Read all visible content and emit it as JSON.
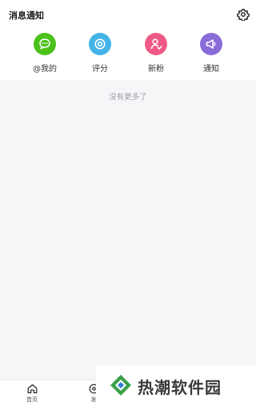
{
  "header": {
    "title": "消息通知",
    "settings_icon": "gear-icon"
  },
  "categories": [
    {
      "label": "@我的",
      "icon": "chat-bubble-icon",
      "color": "#4cc11a"
    },
    {
      "label": "评分",
      "icon": "rating-target-icon",
      "color": "#44b3e7"
    },
    {
      "label": "新粉",
      "icon": "new-follower-icon",
      "color": "#ee5a86"
    },
    {
      "label": "通知",
      "icon": "megaphone-icon",
      "color": "#8a6cd8"
    }
  ],
  "status": {
    "empty_text": "没有更多了"
  },
  "tabbar": {
    "items": [
      {
        "label": "首页",
        "icon": "home-icon"
      },
      {
        "label": "发",
        "icon": "discover-icon"
      }
    ]
  },
  "watermark": {
    "text": "热潮软件园",
    "icon": "diamond-logo"
  },
  "colors": {
    "background": "#f5f6f8",
    "muted_text": "#9b9ea4"
  }
}
